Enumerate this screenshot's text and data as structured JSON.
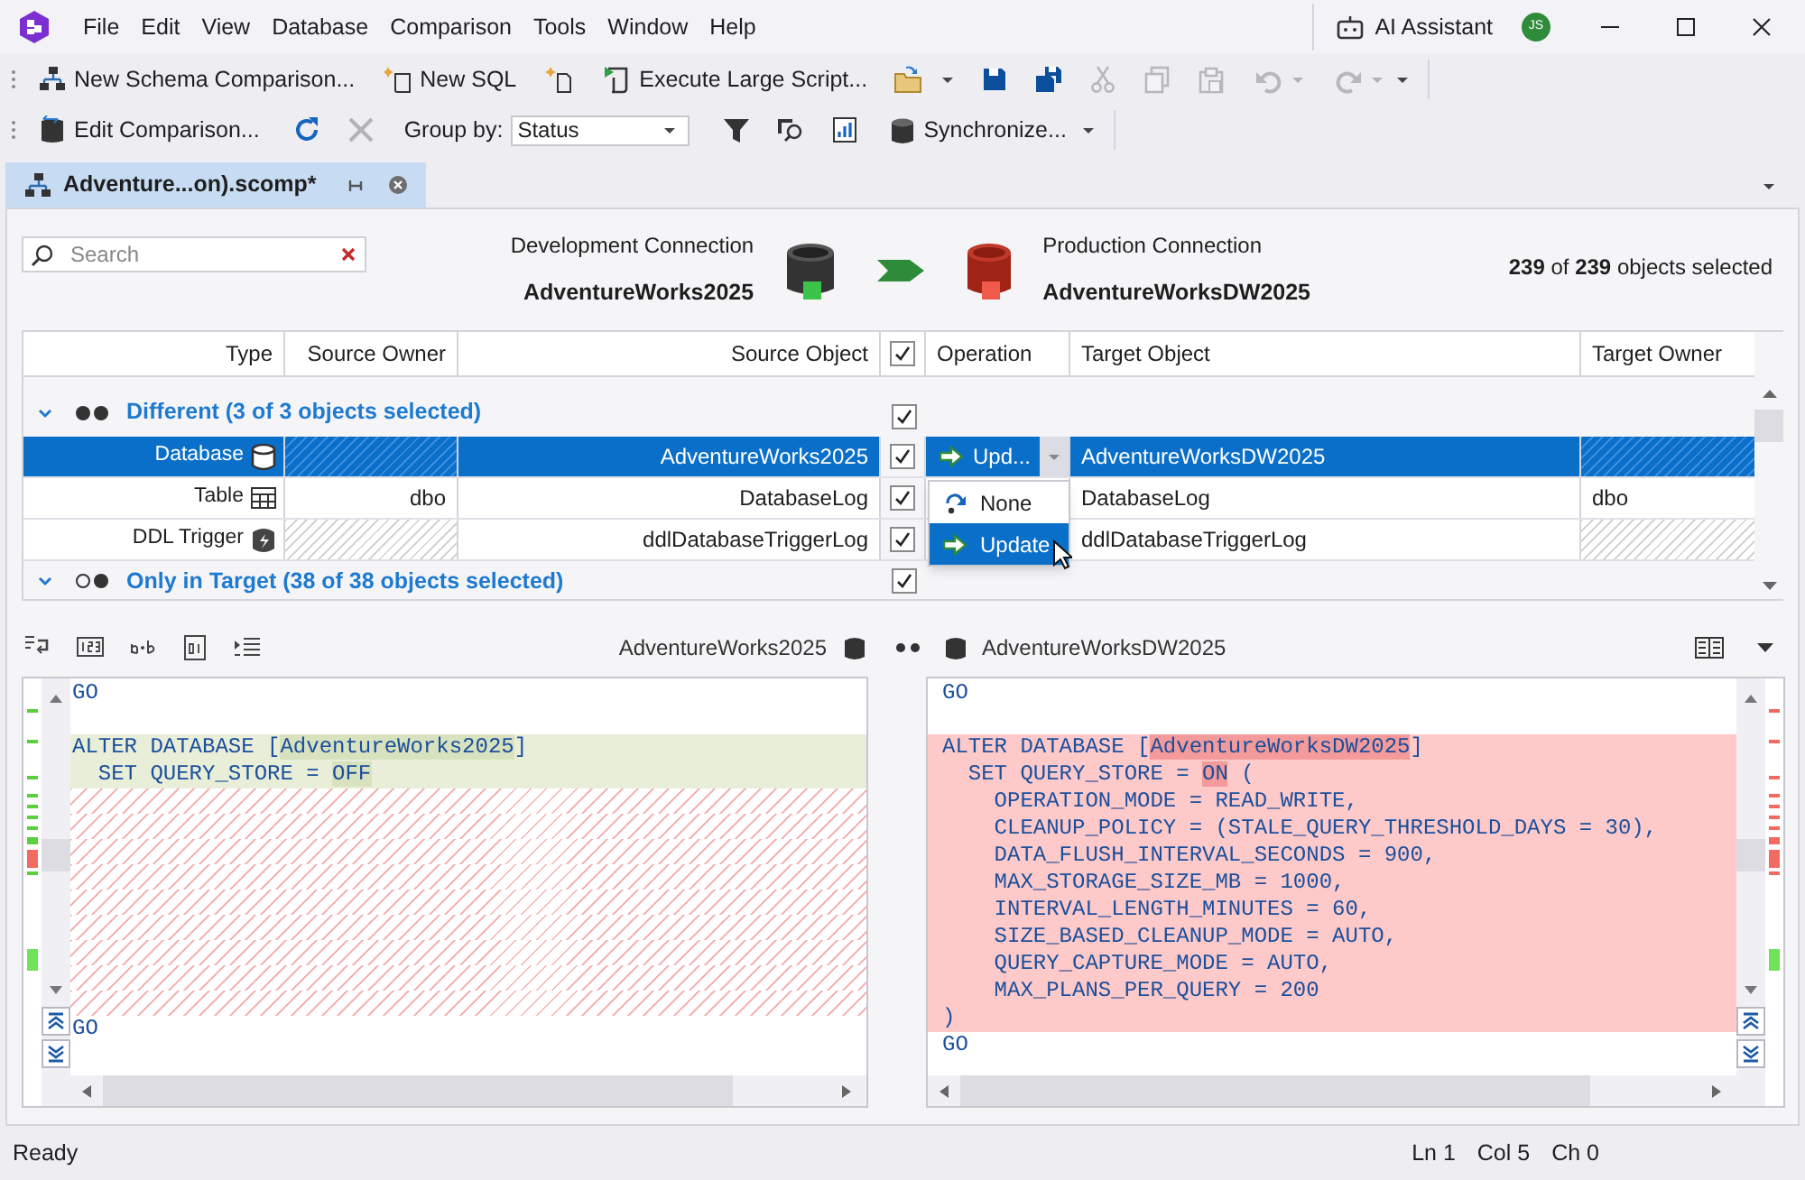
{
  "menu": [
    "File",
    "Edit",
    "View",
    "Database",
    "Comparison",
    "Tools",
    "Window",
    "Help"
  ],
  "account": {
    "assistant": "AI Assistant",
    "avatar": "JS"
  },
  "toolbar_1": [
    {
      "kind": "text_button",
      "label": "New Schema Comparison...",
      "disabled": false
    },
    {
      "kind": "text_button",
      "label": "New SQL",
      "disabled": false
    },
    {
      "kind": "icon_button",
      "disabled": false
    },
    {
      "kind": "text_button",
      "label": "Execute Large Script...",
      "disabled": false
    },
    {
      "kind": "icon_button",
      "disabled": false
    },
    {
      "kind": "caret",
      "disabled": false
    },
    {
      "kind": "icon_button",
      "disabled": false
    },
    {
      "kind": "icon_button",
      "disabled": false
    },
    {
      "kind": "icon_button",
      "disabled": true
    },
    {
      "kind": "icon_button",
      "disabled": true
    },
    {
      "kind": "icon_button",
      "disabled": true
    },
    {
      "kind": "icon_button",
      "disabled": true
    },
    {
      "kind": "caret",
      "disabled": true
    },
    {
      "kind": "icon_button",
      "disabled": true
    },
    {
      "kind": "caret",
      "disabled": true
    },
    {
      "kind": "caret",
      "disabled": false
    }
  ],
  "toolbar_2": [
    {
      "kind": "text_button",
      "label": "Edit Comparison...",
      "disabled": false
    },
    {
      "kind": "icon_button",
      "disabled": false
    },
    {
      "kind": "icon_button",
      "disabled": true
    },
    {
      "kind": "label",
      "label": "Group by:"
    },
    {
      "kind": "select",
      "value": "Status"
    },
    {
      "kind": "icon_button",
      "disabled": false
    },
    {
      "kind": "icon_button",
      "disabled": false
    },
    {
      "kind": "icon_button",
      "disabled": false
    },
    {
      "kind": "text_button",
      "label": "Synchronize...",
      "disabled": false
    },
    {
      "kind": "caret",
      "disabled": false
    }
  ],
  "tabs": [
    {
      "label": "Adventure...on).scomp*",
      "selected": true
    }
  ],
  "search": {
    "placeholder": "Search"
  },
  "source": {
    "caption": "Development Connection",
    "name": "AdventureWorks2025"
  },
  "target": {
    "caption": "Production Connection",
    "name": "AdventureWorksDW2025"
  },
  "selection_summary": "**239** of **239** objects selected",
  "grid": {
    "columns": [
      {
        "kind": "text",
        "label": "Type"
      },
      {
        "kind": "text",
        "label": "Source Owner"
      },
      {
        "kind": "text",
        "label": "Source Object"
      },
      {
        "kind": "checkbox",
        "checked": true
      },
      {
        "kind": "text",
        "label": "Operation"
      },
      {
        "kind": "text",
        "label": "Target Object"
      },
      {
        "kind": "text",
        "label": "Target Owner"
      }
    ],
    "groups": [
      {
        "kind": "different",
        "label": "Different (3 of 3 objects selected)",
        "expanded": true,
        "checked": true,
        "rows": [
          {
            "kind": "database",
            "type": "Database",
            "source_object": "AdventureWorks2025",
            "checked": true,
            "operation": "Upd...",
            "target_object": "AdventureWorksDW2025",
            "selected": true
          },
          {
            "kind": "table",
            "type": "Table",
            "source_owner": "dbo",
            "source_object": "DatabaseLog",
            "checked": true,
            "target_object": "DatabaseLog",
            "target_owner": "dbo",
            "selected": false
          },
          {
            "kind": "trigger",
            "type": "DDL Trigger",
            "source_object": "ddlDatabaseTriggerLog",
            "checked": true,
            "target_object": "ddlDatabaseTriggerLog",
            "selected": false
          }
        ]
      },
      {
        "kind": "only_in_target",
        "label": "Only in Target (38 of 38 objects selected)",
        "expanded": true,
        "checked": true
      }
    ],
    "operation_menu": [
      {
        "label": "None",
        "selected": false
      },
      {
        "label": "Update",
        "selected": true
      }
    ]
  },
  "diff": {
    "source_label": "AdventureWorks2025",
    "target_label": "AdventureWorksDW2025",
    "source_lines": [
      {
        "kind": "plain",
        "segments": [
          {
            "text": "GO"
          }
        ]
      },
      {
        "kind": "blank"
      },
      {
        "kind": "changed",
        "segments": [
          {
            "text": "ALTER DATABASE ["
          },
          {
            "text": "AdventureWorks2025",
            "highlight": true
          },
          {
            "text": "]"
          }
        ]
      },
      {
        "kind": "changed",
        "segments": [
          {
            "text": "  SET QUERY_STORE = "
          },
          {
            "text": "OFF",
            "highlight": true
          }
        ]
      },
      {
        "kind": "filler"
      },
      {
        "kind": "filler"
      },
      {
        "kind": "filler"
      },
      {
        "kind": "filler"
      },
      {
        "kind": "filler"
      },
      {
        "kind": "filler"
      },
      {
        "kind": "filler"
      },
      {
        "kind": "filler"
      },
      {
        "kind": "filler"
      },
      {
        "kind": "plain",
        "segments": [
          {
            "text": "GO"
          }
        ]
      }
    ],
    "target_lines": [
      {
        "kind": "plain",
        "segments": [
          {
            "text": "GO"
          }
        ]
      },
      {
        "kind": "blank"
      },
      {
        "kind": "changed",
        "segments": [
          {
            "text": "ALTER DATABASE ["
          },
          {
            "text": "AdventureWorksDW2025",
            "highlight": true
          },
          {
            "text": "]"
          }
        ]
      },
      {
        "kind": "changed",
        "segments": [
          {
            "text": "  SET QUERY_STORE = "
          },
          {
            "text": "ON",
            "highlight": true
          },
          {
            "text": " ("
          }
        ]
      },
      {
        "kind": "changed",
        "segments": [
          {
            "text": "    OPERATION_MODE = READ_WRITE,"
          }
        ]
      },
      {
        "kind": "changed",
        "segments": [
          {
            "text": "    CLEANUP_POLICY = (STALE_QUERY_THRESHOLD_DAYS = 30),"
          }
        ]
      },
      {
        "kind": "changed",
        "segments": [
          {
            "text": "    DATA_FLUSH_INTERVAL_SECONDS = 900,"
          }
        ]
      },
      {
        "kind": "changed",
        "segments": [
          {
            "text": "    MAX_STORAGE_SIZE_MB = 1000,"
          }
        ]
      },
      {
        "kind": "changed",
        "segments": [
          {
            "text": "    INTERVAL_LENGTH_MINUTES = 60,"
          }
        ]
      },
      {
        "kind": "changed",
        "segments": [
          {
            "text": "    SIZE_BASED_CLEANUP_MODE = AUTO,"
          }
        ]
      },
      {
        "kind": "changed",
        "segments": [
          {
            "text": "    QUERY_CAPTURE_MODE = AUTO,"
          }
        ]
      },
      {
        "kind": "changed",
        "segments": [
          {
            "text": "    MAX_PLANS_PER_QUERY = 200"
          }
        ]
      },
      {
        "kind": "changed",
        "segments": [
          {
            "text": ")"
          }
        ]
      },
      {
        "kind": "plain",
        "segments": [
          {
            "text": "GO"
          }
        ]
      }
    ]
  },
  "status_bar": {
    "message": "Ready",
    "line": "Ln 1",
    "column": "Col 5",
    "char": "Ch 0"
  }
}
